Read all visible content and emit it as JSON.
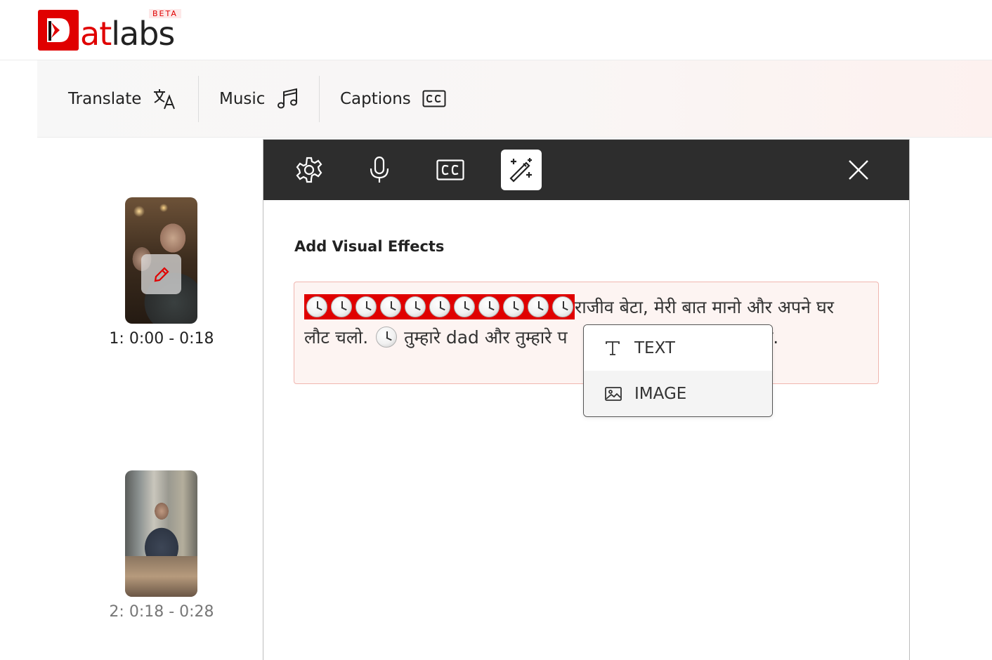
{
  "brand": {
    "name_part1": "at",
    "name_part2": "labs",
    "badge": "BETA",
    "accent_color": "#e00000"
  },
  "toolbar": {
    "items": [
      {
        "label": "Translate",
        "icon": "translate-icon"
      },
      {
        "label": "Music",
        "icon": "music-note-icon"
      },
      {
        "label": "Captions",
        "icon": "closed-captions-icon"
      }
    ]
  },
  "scenes": [
    {
      "label": "1: 0:00 - 0:18",
      "has_edit_button": true
    },
    {
      "label": "2: 0:18 - 0:28",
      "has_edit_button": false
    }
  ],
  "editor": {
    "tabs": [
      {
        "icon": "gear-icon",
        "active": false
      },
      {
        "icon": "microphone-icon",
        "active": false
      },
      {
        "icon": "closed-captions-icon",
        "active": false
      },
      {
        "icon": "magic-wand-icon",
        "active": true
      }
    ],
    "close_icon": "close-icon",
    "section_title": "Add Visual Effects",
    "script_line1_text": "राजीव बेटा, मेरी बात मानो और अपने घर",
    "script_line2_start": "लौट चलो.",
    "script_line2_mid": "तुम्हारे dad और तुम्हारे प",
    "script_line2_end": "है.",
    "highlighted_clock_count": 11
  },
  "effect_menu": {
    "items": [
      {
        "label": "TEXT",
        "icon": "text-type-icon"
      },
      {
        "label": "IMAGE",
        "icon": "image-icon"
      }
    ]
  }
}
